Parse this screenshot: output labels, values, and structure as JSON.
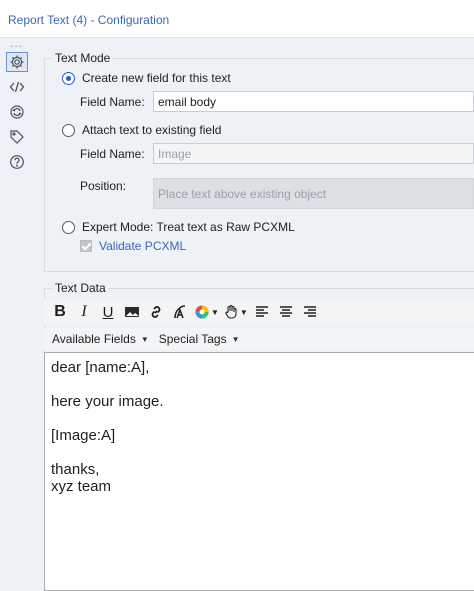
{
  "window": {
    "title": "Report Text (4) - Configuration"
  },
  "sidebar": {
    "dots": "...",
    "icons": [
      {
        "icon": "gear-icon",
        "active": true
      },
      {
        "icon": "code-icon",
        "active": false
      },
      {
        "icon": "cycle-icon",
        "active": false
      },
      {
        "icon": "tag-icon",
        "active": false
      },
      {
        "icon": "help-icon",
        "active": false
      }
    ]
  },
  "text_mode": {
    "group_label": "Text Mode",
    "option_create": "Create new field for this text",
    "create_field_name_label": "Field Name:",
    "create_field_name_value": "email body",
    "option_attach": "Attach text to existing field",
    "attach_field_name_label": "Field Name:",
    "attach_field_name_value": "Image",
    "position_label": "Position:",
    "position_value": "Place text above existing object",
    "option_expert": "Expert Mode: Treat text as Raw PCXML",
    "validate_label": "Validate PCXML",
    "selected": "create"
  },
  "text_data": {
    "group_label": "Text Data",
    "toolbar": {
      "bold": "B",
      "italic": "I",
      "underline": "U"
    },
    "available_fields_label": "Available Fields",
    "special_tags_label": "Special Tags",
    "lines": [
      "dear [name:A],",
      "",
      "here your image.",
      "",
      "[Image:A]",
      "",
      "thanks,",
      "xyz team"
    ]
  },
  "colors": {
    "accent": "#2b5cc4",
    "title": "#3b67b8",
    "panel_bg": "#eef1f5"
  }
}
